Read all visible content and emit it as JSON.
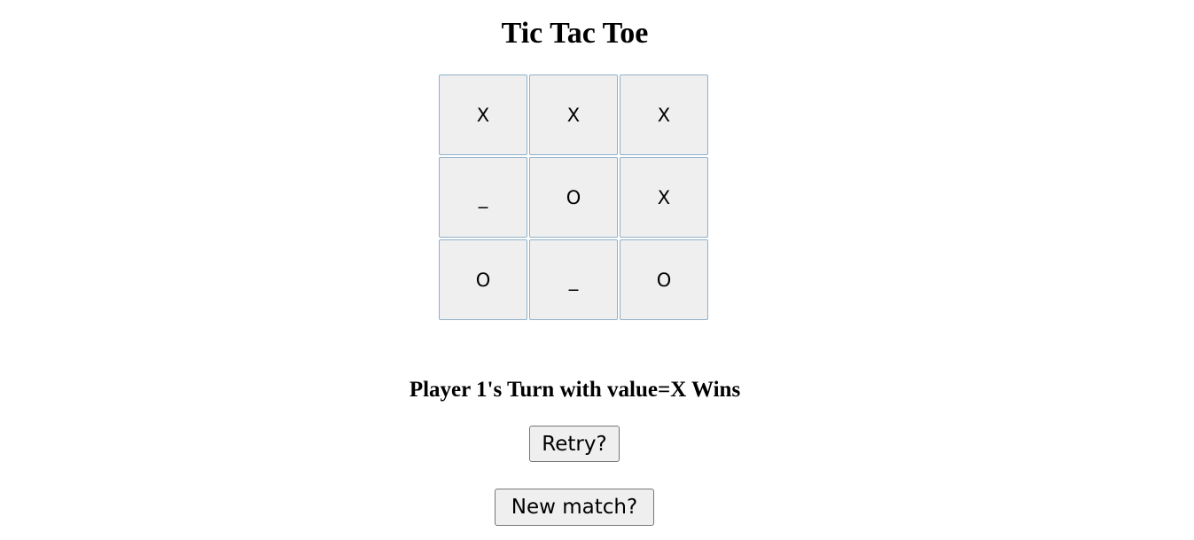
{
  "title": "Tic Tac Toe",
  "board": [
    [
      "X",
      "X",
      "X"
    ],
    [
      "_",
      "O",
      "X"
    ],
    [
      "O",
      "_",
      "O"
    ]
  ],
  "status": "Player 1's Turn with value=X Wins",
  "buttons": {
    "retry": "Retry?",
    "new_match": "New match?"
  }
}
